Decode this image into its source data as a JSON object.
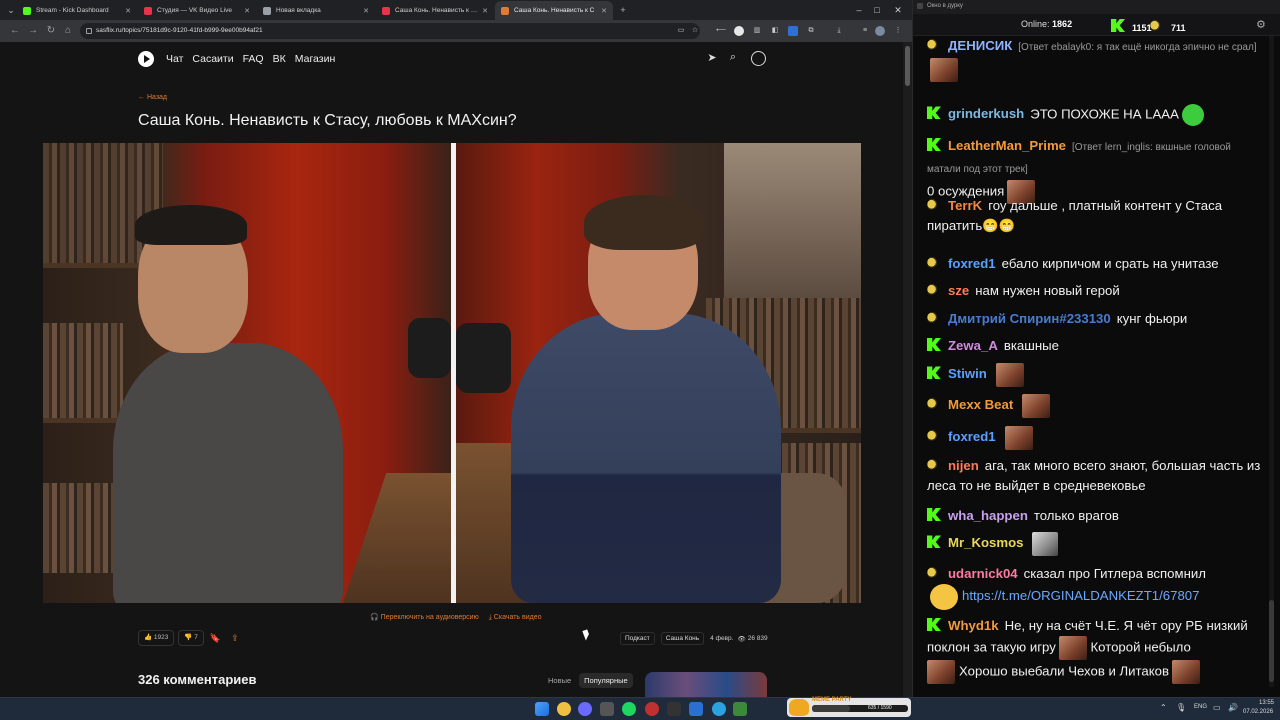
{
  "browser": {
    "tabs": [
      {
        "label": "Stream - Kick Dashboard",
        "favicon_color": "#53fc18"
      },
      {
        "label": "Студия — VK Видео Live",
        "favicon_color": "#e8334a"
      },
      {
        "label": "Новая вкладка",
        "favicon_color": "#9aa0a6"
      },
      {
        "label": "Саша Конь. Ненависть к Стасу",
        "favicon_color": "#e8334a"
      },
      {
        "label": "Саша Конь. Ненависть к С",
        "favicon_color": "#e07a35"
      }
    ],
    "active_tab": 4,
    "url": "sasflix.ru/topics/75181d9c-9120-41fd-b999-9ee00b94af21",
    "new_tab_symbol": "+",
    "window_controls": [
      "–",
      "□",
      "✕"
    ]
  },
  "site": {
    "nav": [
      "Чат",
      "Сасаити",
      "FAQ",
      "ВК",
      "Магазин"
    ],
    "back_label": "← Назад",
    "title": "Саша Конь. Ненависть к Стасу, любовь к МАХсин?",
    "video_links": {
      "audio": "🎧 Переключить на аудиоверсию",
      "download": "⤓ Скачать видео"
    },
    "likes": "1923",
    "dislikes": "7",
    "meta": {
      "category": "Подкаст",
      "guest": "Саша Конь",
      "date": "4 февр.",
      "views": "26 839"
    },
    "comments_title": "326 комментариев",
    "sort": [
      "Новые",
      "Популярные"
    ],
    "sort_selected": 1
  },
  "chat": {
    "window_title": "Окно в дурку",
    "online_label": "Online:",
    "online_count": "1862",
    "kick_count": "1151",
    "other_count": "711",
    "messages": [
      {
        "badge": "b",
        "user": "ДЕНИСИК",
        "color": "#8fb2ff",
        "reply": "[Ответ ebalayk0: я так ещё никогда эпично не срал]",
        "text": "",
        "emote": "face"
      },
      {
        "badge": "k",
        "user": "grinderkush",
        "color": "#7fb8e0",
        "reply": "",
        "text": "ЭТО ПОХОЖЕ НА LAAA",
        "emote": "green"
      },
      {
        "badge": "k",
        "user": "LeatherMan_Prime",
        "color": "#f29a3c",
        "reply": "[Ответ lern_inglis: вкшные головой матали под этот трек]",
        "text": "0 осуждения",
        "emote": "face"
      },
      {
        "badge": "b",
        "user": "TerrK",
        "color": "#f0874a",
        "reply": "",
        "text": "гоу дальше , платный контент у Стаса пиратить😁😁",
        "emote": ""
      },
      {
        "badge": "b",
        "user": "foxred1",
        "color": "#5aa0ff",
        "reply": "",
        "text": "ебало кирпичом и срать на унитазе",
        "emote": ""
      },
      {
        "badge": "b",
        "user": "sze",
        "color": "#ff7a59",
        "reply": "",
        "text": "нам нужен новый герой",
        "emote": ""
      },
      {
        "badge": "b",
        "user": "Дмитрий Спирин#233130",
        "color": "#4a7bd0",
        "reply": "",
        "text": "кунг фьюри",
        "emote": ""
      },
      {
        "badge": "k",
        "user": "Zewa_A",
        "color": "#d08ae0",
        "reply": "",
        "text": "вкашные",
        "emote": ""
      },
      {
        "badge": "k",
        "user": "Stiwin",
        "color": "#5aa0ff",
        "reply": "",
        "text": "",
        "emote": "face"
      },
      {
        "badge": "b",
        "user": "Mexx Beat",
        "color": "#f29a3c",
        "reply": "",
        "text": "",
        "emote": "face"
      },
      {
        "badge": "b",
        "user": "foxred1",
        "color": "#5aa0ff",
        "reply": "",
        "text": "",
        "emote": "face"
      },
      {
        "badge": "b",
        "user": "nijen",
        "color": "#ff7a59",
        "reply": "",
        "text": "ага, так много всего знают, большая часть из леса то не выйдет в средневековье",
        "emote": ""
      },
      {
        "badge": "k",
        "user": "wha_happen",
        "color": "#c8a0f0",
        "reply": "",
        "text": "только врагов",
        "emote": ""
      },
      {
        "badge": "k",
        "user": "Mr_Kosmos",
        "color": "#e8d85a",
        "reply": "",
        "text": "",
        "emote": "shades"
      },
      {
        "badge": "b",
        "user": "udarnick04",
        "color": "#ff7aa0",
        "reply": "",
        "text": "сказал про Гитлера вспомнил",
        "link": "https://t.me/ORGINALDANKEZT1/67807",
        "emote": ""
      },
      {
        "badge": "k",
        "user": "Whyd1k",
        "color": "#f29a3c",
        "reply": "",
        "text": "Не, ну на счёт Ч.Е. Я чёт ору РБ низкий поклон за такую игру",
        "text2": "Которой небыло",
        "text3": "Хорошо выебали Чехов и Литаков",
        "emote": "face"
      }
    ]
  },
  "taskbar": {
    "widget_title": "MEME PARTY",
    "widget_count": "635 / 1590",
    "widget_progress": 0.4,
    "lang": "ENG",
    "time": "13:55",
    "date": "07.02.2026"
  }
}
